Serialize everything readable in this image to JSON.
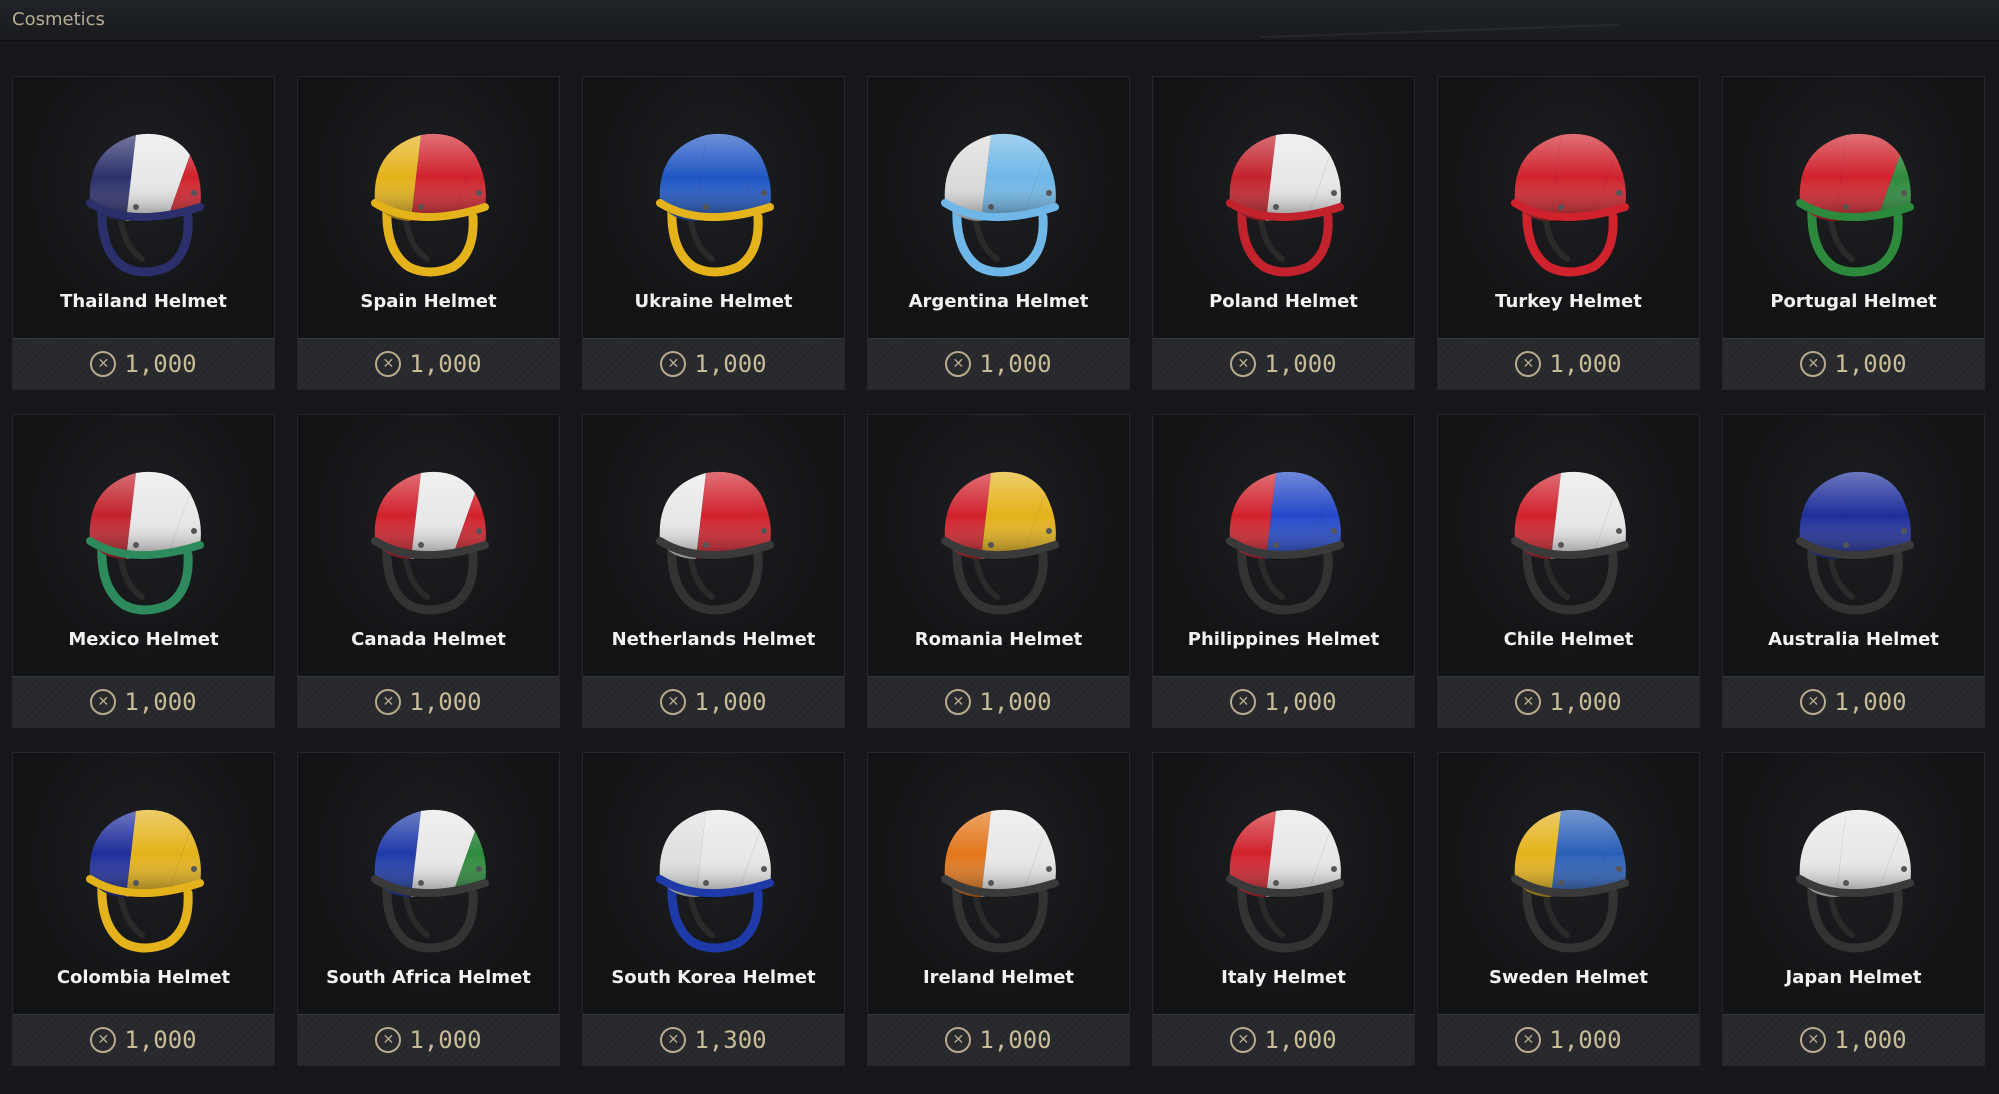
{
  "header": {
    "title": "Cosmetics"
  },
  "currency_icon": "credits-coin-icon",
  "items": [
    {
      "name": "Thailand Helmet",
      "price": "1,000",
      "colors": [
        "#2b2f6b",
        "#e8e8e8",
        "#d0222c"
      ],
      "strap": "#2b2f6b"
    },
    {
      "name": "Spain Helmet",
      "price": "1,000",
      "colors": [
        "#e4b21a",
        "#d0222c",
        "#d0222c"
      ],
      "strap": "#e4b21a"
    },
    {
      "name": "Ukraine Helmet",
      "price": "1,000",
      "colors": [
        "#1f56c4",
        "#1f56c4",
        "#1f56c4"
      ],
      "strap": "#e4b21a"
    },
    {
      "name": "Argentina Helmet",
      "price": "1,000",
      "colors": [
        "#dcdcdc",
        "#6fb7e8",
        "#6fb7e8"
      ],
      "strap": "#6fb7e8"
    },
    {
      "name": "Poland Helmet",
      "price": "1,000",
      "colors": [
        "#c2222c",
        "#e8e8e8",
        "#e8e8e8"
      ],
      "strap": "#c2222c"
    },
    {
      "name": "Turkey Helmet",
      "price": "1,000",
      "colors": [
        "#d0222c",
        "#d0222c",
        "#d0222c"
      ],
      "strap": "#d0222c"
    },
    {
      "name": "Portugal Helmet",
      "price": "1,000",
      "colors": [
        "#d0222c",
        "#d0222c",
        "#2d8a3c"
      ],
      "strap": "#2d8a3c"
    },
    {
      "name": "Mexico Helmet",
      "price": "1,000",
      "colors": [
        "#c2222c",
        "#e8e8e8",
        "#e8e8e8"
      ],
      "strap": "#2d8a5c"
    },
    {
      "name": "Canada Helmet",
      "price": "1,000",
      "colors": [
        "#d0222c",
        "#e8e8e8",
        "#d0222c"
      ],
      "strap": "#333333"
    },
    {
      "name": "Netherlands Helmet",
      "price": "1,000",
      "colors": [
        "#e8e8e8",
        "#d0222c",
        "#d0222c"
      ],
      "strap": "#333333"
    },
    {
      "name": "Romania Helmet",
      "price": "1,000",
      "colors": [
        "#d0222c",
        "#e4b21a",
        "#e4b21a"
      ],
      "strap": "#333333"
    },
    {
      "name": "Philippines Helmet",
      "price": "1,000",
      "colors": [
        "#d0222c",
        "#2448c8",
        "#2448c8"
      ],
      "strap": "#333333"
    },
    {
      "name": "Chile Helmet",
      "price": "1,000",
      "colors": [
        "#d0222c",
        "#e8e8e8",
        "#e8e8e8"
      ],
      "strap": "#333333"
    },
    {
      "name": "Australia Helmet",
      "price": "1,000",
      "colors": [
        "#1e2e9a",
        "#1e2e9a",
        "#1e2e9a"
      ],
      "strap": "#333333"
    },
    {
      "name": "Colombia Helmet",
      "price": "1,000",
      "colors": [
        "#1e2e9a",
        "#e4b21a",
        "#e4b21a"
      ],
      "strap": "#e4b21a"
    },
    {
      "name": "South Africa Helmet",
      "price": "1,000",
      "colors": [
        "#1e3aa8",
        "#e8e8e8",
        "#2d8a3c"
      ],
      "strap": "#333333"
    },
    {
      "name": "South Korea Helmet",
      "price": "1,300",
      "colors": [
        "#e0e0e0",
        "#e8e8e8",
        "#e8e8e8"
      ],
      "strap": "#1e3aa8"
    },
    {
      "name": "Ireland Helmet",
      "price": "1,000",
      "colors": [
        "#e2761a",
        "#e8e8e8",
        "#e8e8e8"
      ],
      "strap": "#333333"
    },
    {
      "name": "Italy Helmet",
      "price": "1,000",
      "colors": [
        "#d0222c",
        "#e8e8e8",
        "#e8e8e8"
      ],
      "strap": "#333333"
    },
    {
      "name": "Sweden Helmet",
      "price": "1,000",
      "colors": [
        "#e4b21a",
        "#2a5fb8",
        "#2a5fb8"
      ],
      "strap": "#333333"
    },
    {
      "name": "Japan Helmet",
      "price": "1,000",
      "colors": [
        "#e8e8e8",
        "#e8e8e8",
        "#e8e8e8"
      ],
      "strap": "#333333"
    }
  ]
}
